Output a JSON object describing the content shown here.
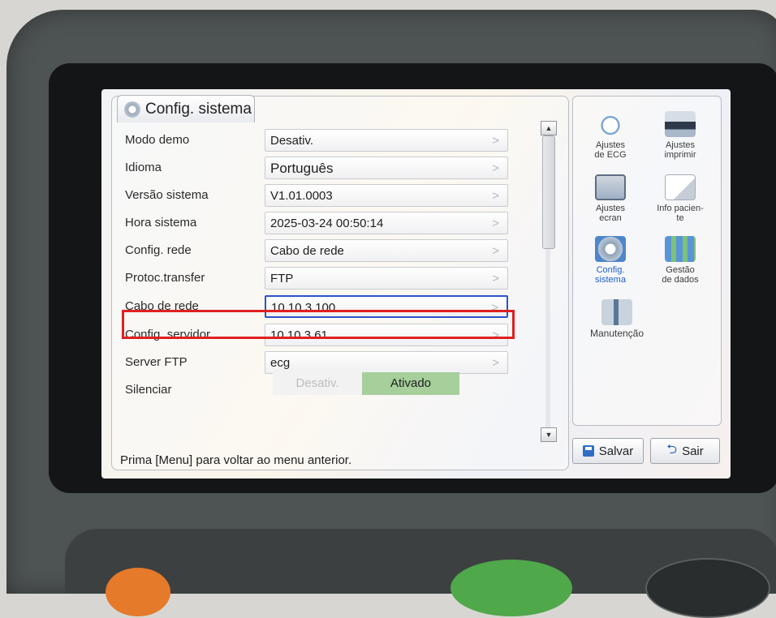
{
  "window": {
    "title": "Config. sistema"
  },
  "rows": [
    {
      "label": "Modo demo",
      "value": "Desativ."
    },
    {
      "label": "Idioma",
      "value": "Português"
    },
    {
      "label": "Versão sistema",
      "value": "V1.01.0003"
    },
    {
      "label": "Hora sistema",
      "value": "2025-03-24 00:50:14"
    },
    {
      "label": "Config. rede",
      "value": "Cabo de rede"
    },
    {
      "label": "Protoc.transfer",
      "value": "FTP"
    },
    {
      "label": "Cabo de rede",
      "value": "10.10.3.100"
    },
    {
      "label": "Config. servidor",
      "value": "10.10.3.61"
    },
    {
      "label": "Server FTP",
      "value": "ecg"
    }
  ],
  "mute": {
    "label": "Silenciar",
    "off": "Desativ.",
    "on": "Ativado",
    "selected": "on"
  },
  "chevron": ">",
  "scroll": {
    "up": "▲",
    "down": "▼"
  },
  "status": "Prima [Menu] para voltar ao menu anterior.",
  "side_menu": [
    {
      "line1": "Ajustes",
      "line2": "de ECG",
      "icon": "heart-ecg-icon"
    },
    {
      "line1": "Ajustes",
      "line2": "imprimir",
      "icon": "printer-icon"
    },
    {
      "line1": "Ajustes",
      "line2": "ecran",
      "icon": "monitor-icon"
    },
    {
      "line1": "Info pacien-",
      "line2": "te",
      "icon": "document-icon"
    },
    {
      "line1": "Config.",
      "line2": "sistema",
      "icon": "gear-icon",
      "selected": true
    },
    {
      "line1": "Gestão",
      "line2": "de dados",
      "icon": "data-icon"
    },
    {
      "line1": "Manutenção",
      "line2": "",
      "icon": "tools-icon"
    }
  ],
  "buttons": {
    "save": "Salvar",
    "exit": "Sair"
  },
  "colors": {
    "highlight": "#e02020",
    "active_border": "#2a55c8",
    "toggle_on": "#a6cf9b"
  }
}
